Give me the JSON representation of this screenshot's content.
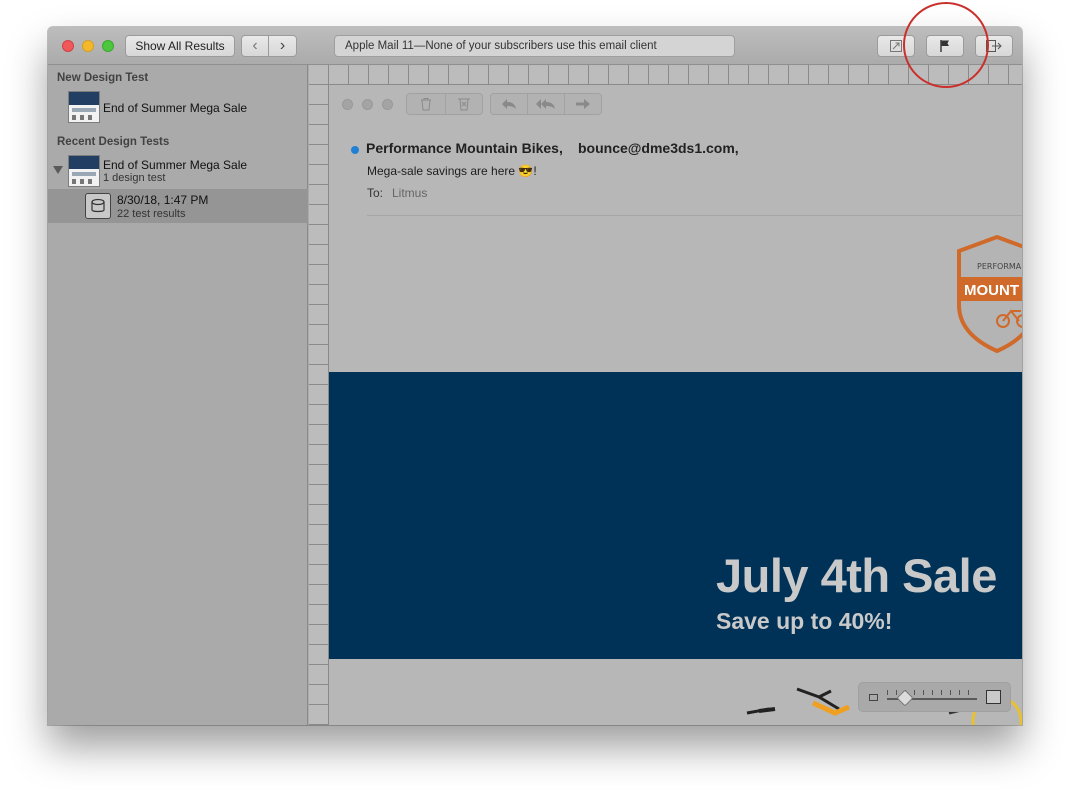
{
  "window": {
    "toolbar": {
      "show_all_label": "Show All Results",
      "back_label": "‹",
      "forward_label": "›",
      "title_text": "Apple Mail 11—None of your subscribers use this email client",
      "icons": [
        "expand-icon",
        "flag-icon",
        "export-icon"
      ]
    }
  },
  "sidebar": {
    "new_heading": "New Design Test",
    "new_item_label": "End of Summer Mega Sale",
    "recent_heading": "Recent Design Tests",
    "recent_item": {
      "label": "End of Summer Mega Sale",
      "sub": "1 design test"
    },
    "selected_result": {
      "date": "8/30/18, 1:47 PM",
      "count": "22 test results"
    }
  },
  "mail": {
    "from_name": "Performance Mountain Bikes,",
    "from_email": "bounce@dme3ds1.com,",
    "subject": "Mega-sale savings are here 😎!",
    "to_label": "To:",
    "to_value": "Litmus",
    "badge_top": "PERFORMANCE",
    "badge_main": "MOUNT",
    "banner_title": "July 4th Sale",
    "banner_subtitle": "Save up to 40%!"
  },
  "colors": {
    "banner_bg": "#003157",
    "badge_orange": "#d06a2a",
    "unread_dot": "#1f80d4",
    "annotation_red": "#c9302c"
  }
}
